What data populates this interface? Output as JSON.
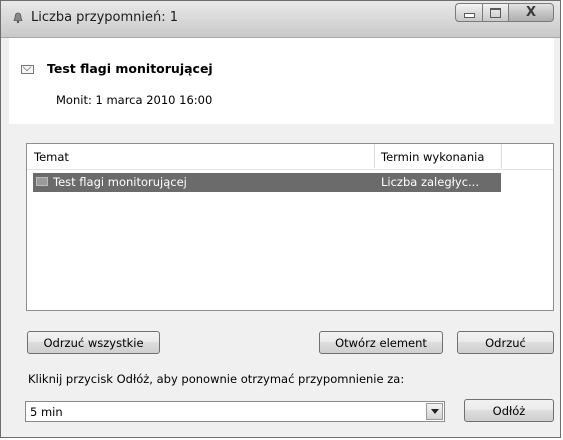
{
  "window": {
    "title": "Liczba przypomnień: 1",
    "title_icon": "reminder-bell-icon"
  },
  "caption_buttons": {
    "minimize": "minimize-icon",
    "maximize": "maximize-icon",
    "close_glyph": "X"
  },
  "reminder": {
    "item_icon": "envelope-icon",
    "subject": "Test flagi monitorującej",
    "due_label": "Monit: 1 marca 2010 16:00"
  },
  "list": {
    "columns": [
      "Temat",
      "Termin wykonania"
    ],
    "rows": [
      {
        "icon": "envelope-icon",
        "subject": "Test flagi monitorującej",
        "due": "Liczba zaległyc...",
        "selected": true
      }
    ]
  },
  "buttons": {
    "dismiss_all": "Odrzuć wszystkie",
    "open_item": "Otwórz element",
    "dismiss": "Odrzuć",
    "snooze": "Odłóż"
  },
  "snooze": {
    "prompt": "Kliknij przycisk Odłóż, aby ponownie otrzymać przypomnienie za:",
    "selected_value": "5 min"
  },
  "colors": {
    "selection_bg": "#6b6b6b",
    "window_bg": "#f0f0f0"
  }
}
